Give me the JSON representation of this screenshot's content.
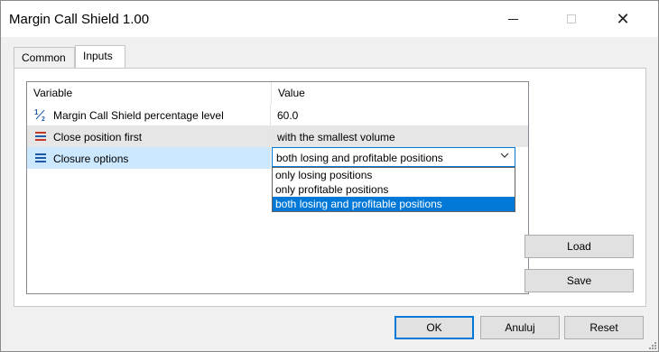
{
  "window": {
    "title": "Margin Call Shield 1.00"
  },
  "tabs": [
    {
      "label": "Common",
      "active": false
    },
    {
      "label": "Inputs",
      "active": true
    }
  ],
  "grid": {
    "headers": {
      "variable": "Variable",
      "value": "Value"
    },
    "rows": [
      {
        "icon": "fraction-icon",
        "variable": "Margin Call Shield percentage level",
        "value": "60.0"
      },
      {
        "icon": "enum-list-icon",
        "variable": "Close position first",
        "value": "with the smallest volume"
      },
      {
        "icon": "enum-list-icon",
        "variable": "Closure options",
        "value": "both losing and profitable positions"
      }
    ]
  },
  "dropdown": {
    "selected": "both losing and profitable positions",
    "options": [
      "only losing positions",
      "only profitable positions",
      "both losing and profitable positions"
    ]
  },
  "side_buttons": {
    "load": "Load",
    "save": "Save"
  },
  "footer_buttons": {
    "ok": "OK",
    "cancel": "Anuluj",
    "reset": "Reset"
  },
  "colors": {
    "accent": "#0078d7",
    "selection": "#cce8ff",
    "enum_icon": "#c0392b",
    "fraction_icon": "#1e5aa8"
  }
}
